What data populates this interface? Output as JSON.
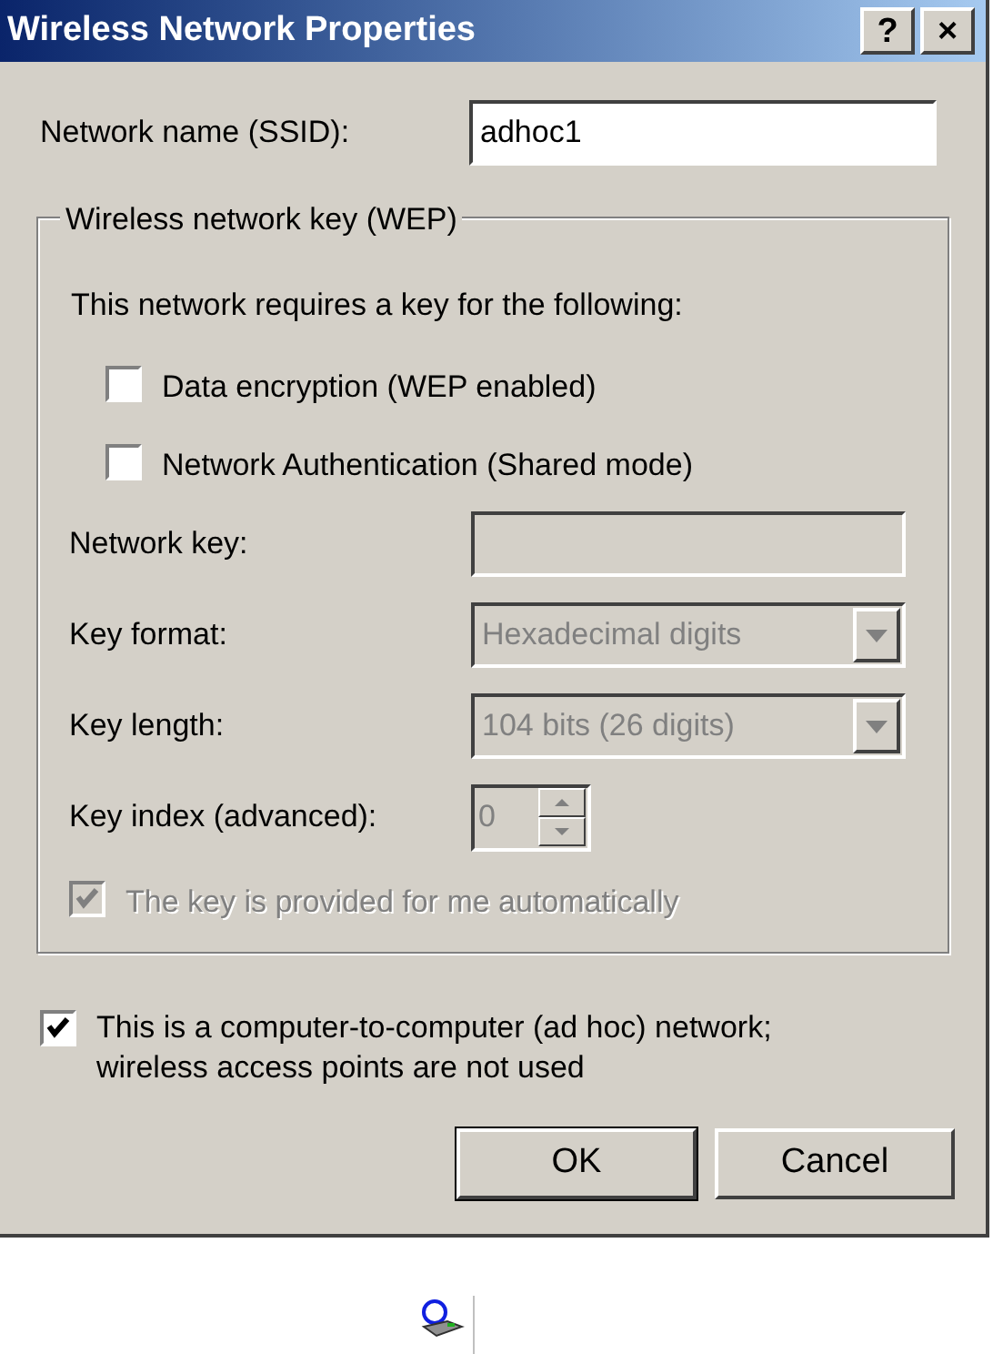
{
  "window": {
    "title": "Wireless Network Properties",
    "title_buttons": [
      "?",
      "×"
    ]
  },
  "ssid": {
    "label": "Network name (SSID):",
    "value": "adhoc1"
  },
  "group": {
    "legend": "Wireless network key (WEP)",
    "intro": "This network requires a key for the following:",
    "options": [
      {
        "label": "Data encryption (WEP enabled)",
        "checked": false,
        "disabled": false
      },
      {
        "label": "Network Authentication (Shared mode)",
        "checked": false,
        "disabled": false
      }
    ],
    "fields": [
      {
        "kind": "text",
        "label": "Network key:",
        "disabled": true
      },
      {
        "kind": "select",
        "label": "Key format:",
        "value": "Hexadecimal digits",
        "disabled": true
      },
      {
        "kind": "select",
        "label": "Key length:",
        "value": "104 bits (26 digits)",
        "disabled": true
      },
      {
        "kind": "spin",
        "label": "Key index (advanced):",
        "value": "0",
        "disabled": true
      }
    ],
    "auto": {
      "label": "The key is provided for me automatically",
      "checked": true,
      "disabled": true
    }
  },
  "adhoc": {
    "label": "This is a computer-to-computer (ad hoc) network; wireless access points are not used",
    "checked": true,
    "disabled": false
  },
  "buttons": [
    {
      "label": "OK",
      "default": true
    },
    {
      "label": "Cancel",
      "default": false
    }
  ]
}
